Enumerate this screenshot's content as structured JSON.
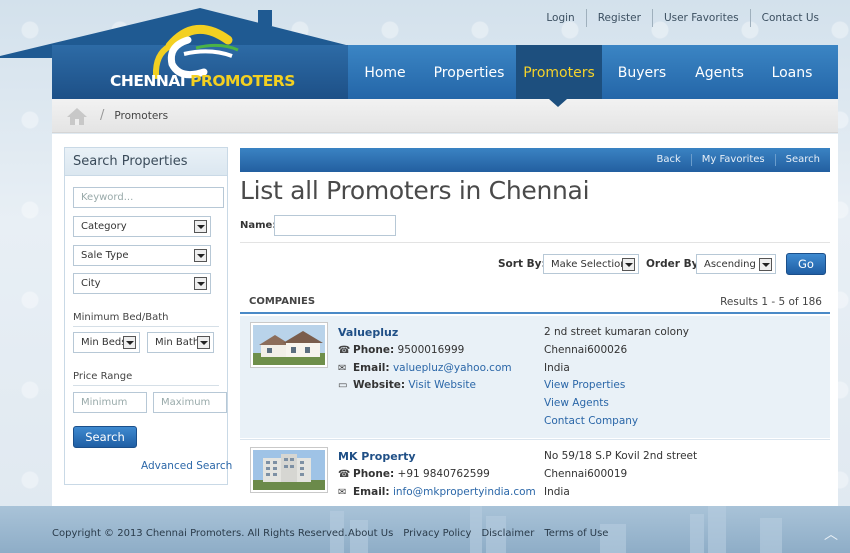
{
  "topnav": [
    "Login",
    "Register",
    "User Favorites",
    "Contact Us"
  ],
  "logo": {
    "part1": "CHENNAI",
    "part2": "PROMOTERS"
  },
  "mainnav": [
    {
      "label": "Home",
      "active": false
    },
    {
      "label": "Properties",
      "active": false
    },
    {
      "label": "Promoters",
      "active": true
    },
    {
      "label": "Buyers",
      "active": false
    },
    {
      "label": "Agents",
      "active": false
    },
    {
      "label": "Loans",
      "active": false
    }
  ],
  "breadcrumb": {
    "current": "Promoters",
    "separator": "/"
  },
  "sidebar": {
    "title": "Search Properties",
    "keyword_placeholder": "Keyword...",
    "category": "Category",
    "sale_type": "Sale Type",
    "city": "City",
    "bed_bath_label": "Minimum Bed/Bath",
    "min_beds": "Min Beds",
    "min_baths": "Min Baths",
    "price_label": "Price Range",
    "min_placeholder": "Minimum",
    "max_placeholder": "Maximum",
    "search_button": "Search",
    "advanced_link": "Advanced Search"
  },
  "main": {
    "bar_links": [
      "Back",
      "My Favorites",
      "Search"
    ],
    "title": "List all Promoters in Chennai",
    "name_label": "Name:",
    "sort_label": "Sort By:",
    "sort_value": "Make Selection",
    "order_label": "Order By:",
    "order_value": "Ascending",
    "go_button": "Go",
    "companies_label": "COMPANIES",
    "results": "Results 1 - 5 of 186"
  },
  "companies": [
    {
      "name": "Valuepluz",
      "phone_label": "Phone:",
      "phone": "9500016999",
      "email_label": "Email:",
      "email": "valuepluz@yahoo.com",
      "website_label": "Website:",
      "website": "Visit Website",
      "address": [
        "2 nd street kumaran colony",
        "Chennai600026",
        "India"
      ],
      "links": [
        "View Properties",
        "View Agents",
        "Contact Company"
      ]
    },
    {
      "name": "MK Property",
      "phone_label": "Phone:",
      "phone": "+91 9840762599",
      "email_label": "Email:",
      "email": "info@mkpropertyindia.com",
      "address": [
        "No 59/18 S.P Kovil 2nd street",
        "Chennai600019",
        "India"
      ]
    }
  ],
  "footer": {
    "copyright": "Copyright © 2013 Chennai Promoters. All Rights Reserved.",
    "links": [
      "About Us",
      "Privacy Policy",
      "Disclaimer",
      "Terms of Use"
    ]
  },
  "colors": {
    "nav_blue": "#2d6ba6",
    "active_nav": "#1d4f7e",
    "accent_yellow": "#f3d021",
    "link_blue": "#2b67a8"
  },
  "icons": [
    "home-icon",
    "phone-icon",
    "email-icon",
    "monitor-icon",
    "chevron-down-icon",
    "scroll-top-icon"
  ]
}
